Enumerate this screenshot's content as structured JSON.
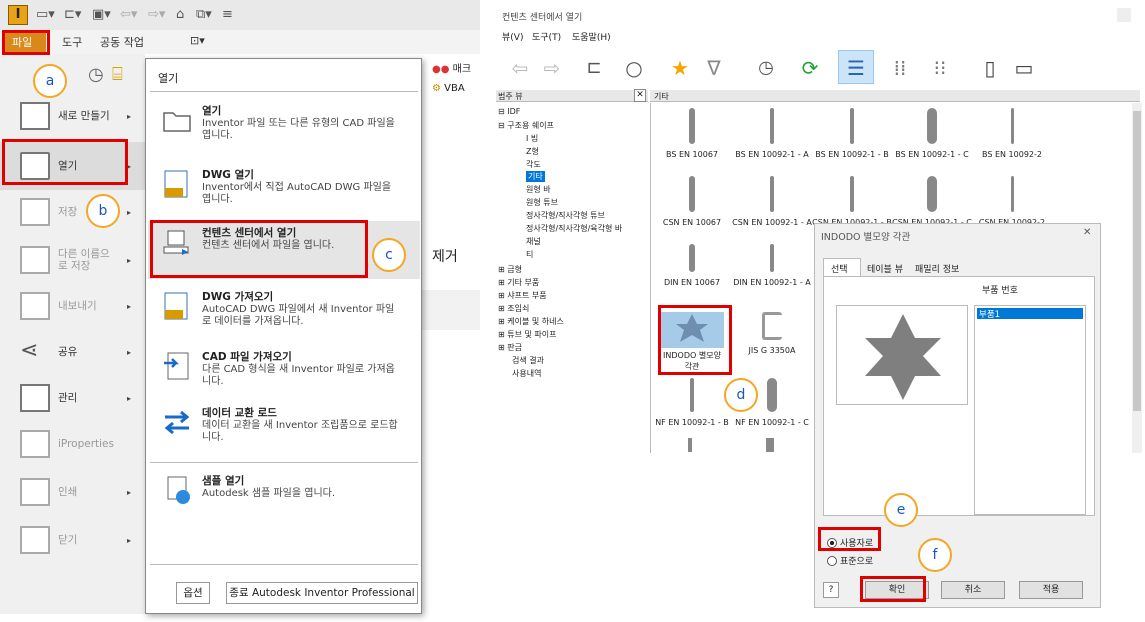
{
  "left": {
    "menubar": {
      "file": "파일",
      "tools": "도구",
      "collab": "공동 작업",
      "extra": "⊡▾"
    },
    "ribbon_right": {
      "a": "매크",
      "b": "VBA",
      "remove": "제거"
    },
    "menu": [
      {
        "label": "새로 만들기",
        "arrow": "▸"
      },
      {
        "label": "열기",
        "arrow": "▸"
      },
      {
        "label": "저장",
        "arrow": "▸"
      },
      {
        "label": "다른 이름으로 저장",
        "arrow": "▸"
      },
      {
        "label": "내보내기",
        "arrow": "▸"
      },
      {
        "label": "공유",
        "arrow": "▸"
      },
      {
        "label": "관리",
        "arrow": "▸"
      },
      {
        "label": "iProperties",
        "arrow": ""
      },
      {
        "label": "인쇄",
        "arrow": "▸"
      },
      {
        "label": "닫기",
        "arrow": "▸"
      }
    ],
    "panel": {
      "title": "열기",
      "items": [
        {
          "title": "열기",
          "desc": "Inventor 파일 또는 다른 유형의 CAD 파일을 엽니다."
        },
        {
          "title": "DWG 열기",
          "desc": "Inventor에서 직접 AutoCAD DWG 파일을 엽니다."
        },
        {
          "title": "컨텐츠 센터에서 열기",
          "desc": "컨텐츠 센터에서 파일을 엽니다."
        },
        {
          "title": "DWG 가져오기",
          "desc": "AutoCAD DWG 파일에서 새 Inventor 파일로 데이터를 가져옵니다."
        },
        {
          "title": "CAD 파일 가져오기",
          "desc": "다른 CAD 형식을 새 Inventor 파일로 가져옵니다."
        },
        {
          "title": "데이터 교환 로드",
          "desc": "데이터 교환을 새 Inventor 조립품으로 로드합니다."
        },
        {
          "title": "샘플 열기",
          "desc": "Autodesk 샘플 파일을 엽니다."
        }
      ],
      "dwg_badge": "DWG",
      "options_btn": "옵션",
      "exit_btn": "종료 Autodesk Inventor Professional"
    }
  },
  "right": {
    "window_title": "컨텐츠 센터에서 열기",
    "menus": [
      "뷰(V)",
      "도구(T)",
      "도움말(H)"
    ],
    "tree_header": "범주 뷰",
    "tree_close": "✕",
    "content_header": "기타",
    "tree": [
      "⊟ IDF",
      "⊟ 구조용 쉐이프",
      "I 빔",
      "Z형",
      "각도",
      "기타",
      "원형 바",
      "원형 튜브",
      "정사각형/직사각형 튜브",
      "정사각형/직사각형/육각형 바",
      "채널",
      "티",
      "⊞ 금형",
      "⊞ 기타 부품",
      "⊞ 샤프트 부품",
      "⊞ 조임쇠",
      "⊞ 케이블 및 하네스",
      "⊞ 튜브 및 파이프",
      "⊞ 판금",
      "검색 결과",
      "사용내역"
    ],
    "tiles": [
      "BS EN 10067",
      "BS EN 10092-1 - A",
      "BS EN 10092-1 - B",
      "BS EN 10092-1 - C",
      "BS EN 10092-2",
      "CSN EN 10067",
      "CSN EN 10092-1 - A",
      "CSN EN 10092-1 - B",
      "CSN EN 10092-1 - C",
      "CSN EN 10092-2",
      "DIN EN 10067",
      "DIN EN 10092-1 - A",
      "INDODO 별모양 각관",
      "JIS G 3350A",
      "NF EN 10092-1 - B",
      "NF EN 10092-1 - C"
    ],
    "dialog": {
      "title": "INDODO 별모양 각관",
      "close": "✕",
      "tabs": [
        "선택",
        "테이블 뷰",
        "패밀리 정보"
      ],
      "part_no_label": "부품 번호",
      "part_value": "부품1",
      "radio_user": "사용자로",
      "radio_std": "표준으로",
      "help": "?",
      "ok": "확인",
      "cancel": "취소",
      "apply": "적용"
    }
  },
  "callouts": {
    "a": "a",
    "b": "b",
    "c": "c",
    "d": "d",
    "e": "e",
    "f": "f"
  },
  "colors": {
    "highlight": "#e00000",
    "callout_ring": "#f5a623",
    "callout_text": "#1a55c7",
    "tree_select": "#0078d7"
  }
}
